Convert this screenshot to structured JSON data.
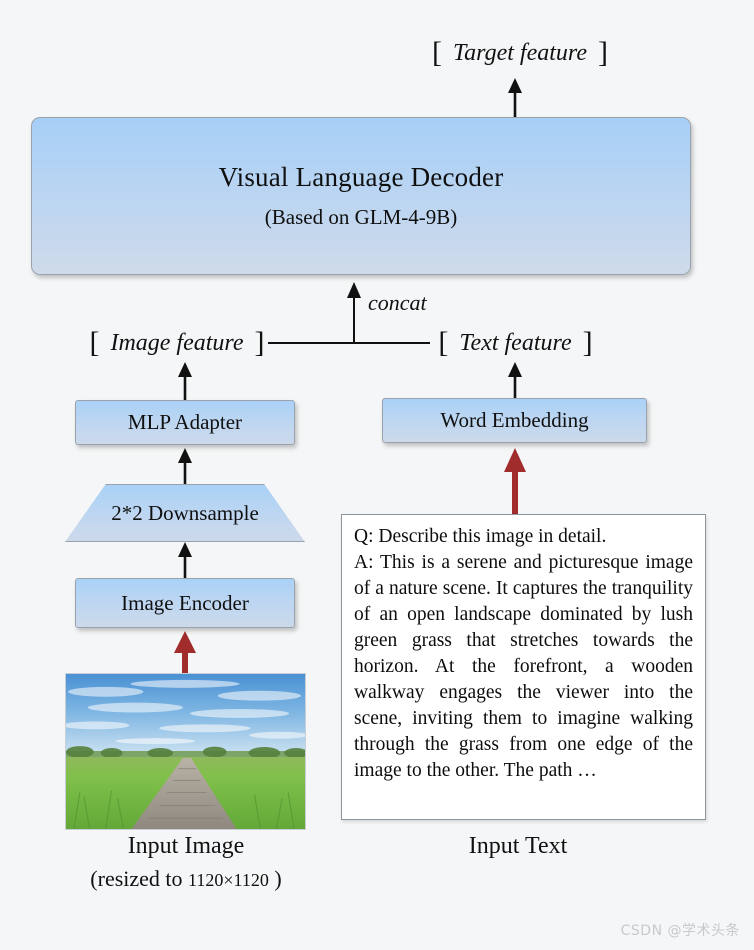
{
  "background_color": "#f5f6f7",
  "diagram": {
    "title_flow": "GLM-4V style vision-language model architecture",
    "target_feature": {
      "open_bracket": "[",
      "label": "Target feature",
      "close_bracket": "]"
    },
    "decoder": {
      "title": "Visual Language Decoder",
      "subtitle": "(Based on GLM-4-9B)",
      "fill_top_color": "#a6cff6",
      "fill_bottom_color": "#cfdaea",
      "border_color": "#9aa3ad"
    },
    "concat": {
      "label": "concat",
      "image_feature": {
        "open_bracket": "[",
        "label": "Image feature",
        "close_bracket": "]"
      },
      "text_feature": {
        "open_bracket": "[",
        "label": "Text feature",
        "close_bracket": "]"
      }
    },
    "mlp_adapter": {
      "label": "MLP Adapter"
    },
    "word_embedding": {
      "label": "Word Embedding"
    },
    "downsample": {
      "label": "2*2 Downsample"
    },
    "image_encoder": {
      "label": "Image Encoder"
    },
    "input_text_box": {
      "question": "Q: Describe this image in detail.",
      "answer": "A: This is a serene and picturesque image of a nature scene. It captures the tranquility of an open landscape dominated by lush green grass that stretches towards the horizon. At the forefront, a wooden walkway engages the viewer into the scene, inviting them to imagine walking through the grass from one edge of the image to the other. The path …"
    },
    "captions": {
      "input_image": "Input Image",
      "input_image_sub_prefix": "(resized to ",
      "input_image_sub_number": "1120×1120",
      "input_image_sub_suffix": " )",
      "input_text": "Input Text"
    },
    "arrow_colors": {
      "black": "#111111",
      "red": "#a02c2c"
    }
  },
  "watermark": {
    "text": "CSDN @学术头条",
    "color": "#c6c9cd"
  }
}
